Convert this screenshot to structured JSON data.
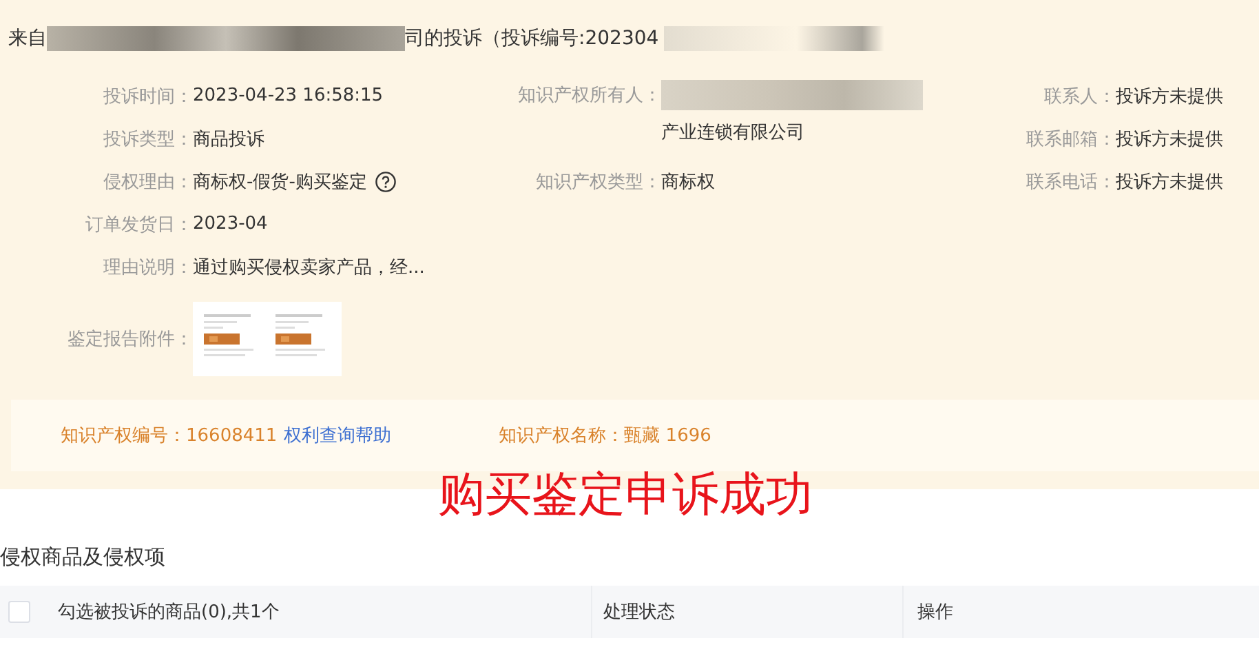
{
  "header": {
    "title_prefix": "来自",
    "title_suffix": "司的投诉（投诉编号:202304"
  },
  "left_fields": [
    {
      "kind": "text",
      "label": "投诉时间：",
      "value": "2023-04-23 16:58:15",
      "help": false
    },
    {
      "kind": "text",
      "label": "投诉类型：",
      "value": "商品投诉",
      "help": false
    },
    {
      "kind": "text",
      "label": "侵权理由：",
      "value": "商标权-假货-购买鉴定",
      "help": true
    },
    {
      "kind": "text",
      "label": "订单发货日：",
      "value": "2023-04",
      "help": false
    },
    {
      "kind": "text",
      "label": "理由说明：",
      "value": "通过购买侵权卖家产品，经...",
      "help": false
    },
    {
      "kind": "attachments",
      "label": "鉴定报告附件："
    }
  ],
  "middle_fields": [
    {
      "label": "知识产权所有人：",
      "value": "产业连锁有限公司",
      "redacted_prefix": true
    },
    {
      "label": "知识产权类型：",
      "value": "商标权",
      "redacted_prefix": false
    }
  ],
  "right_fields": [
    {
      "label": "联系人：",
      "value": "投诉方未提供"
    },
    {
      "label": "联系邮箱：",
      "value": "投诉方未提供"
    },
    {
      "label": "联系电话：",
      "value": "投诉方未提供"
    }
  ],
  "ip_bar": {
    "number_label": "知识产权编号：",
    "number": "16608411",
    "help_link": "权利查询帮助",
    "name_label": "知识产权名称：",
    "name": "甄藏 1696"
  },
  "overlay_caption": "购买鉴定申诉成功",
  "section_title": "侵权商品及侵权项",
  "table": {
    "select_all_checked": false,
    "columns": [
      "勾选被投诉的商品(0),共1个",
      "处理状态",
      "操作"
    ]
  }
}
